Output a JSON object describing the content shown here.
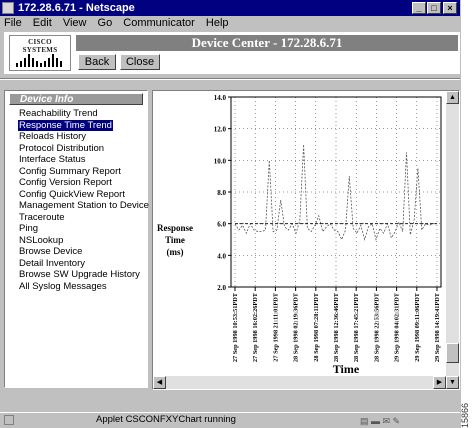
{
  "window": {
    "title": "172.28.6.71 - Netscape"
  },
  "menu": [
    "File",
    "Edit",
    "View",
    "Go",
    "Communicator",
    "Help"
  ],
  "header": {
    "logo_text": "CISCO SYSTEMS",
    "title": "Device Center - 172.28.6.71",
    "back_label": "Back",
    "close_label": "Close"
  },
  "sidebar": {
    "header": "Device Info",
    "items": [
      "Reachability Trend",
      "Response Time Trend",
      "Reloads History",
      "Protocol Distribution",
      "Interface Status",
      "Config Summary Report",
      "Config Version Report",
      "Config QuickView Report",
      "Management Station to Device",
      "Traceroute",
      "Ping",
      "NSLookup",
      "Browse Device",
      "Detail Inventory",
      "Browse SW Upgrade History",
      "All Syslog Messages"
    ],
    "selected_index": 1
  },
  "status": {
    "text": "Applet CSCONFXYChart running"
  },
  "figure_number": "15866",
  "chart_data": {
    "type": "line",
    "ylabel_lines": [
      "Response",
      "Time",
      "(ms)"
    ],
    "xlabel": "Time",
    "ylim": [
      2.0,
      14.0
    ],
    "yticks": [
      "2.0",
      "4.0",
      "6.0",
      "8.0",
      "10.0",
      "12.0",
      "14.0"
    ],
    "xticks": [
      "27 Sep 1998 10:53:51PDT",
      "27 Sep 1998 16:02:26PDT",
      "27 Sep 1998 21:11:01PDT",
      "28 Sep 1998 02:19:36PDT",
      "28 Sep 1998 07:28:11PDT",
      "28 Sep 1998 12:36:46PDT",
      "28 Sep 1998 17:45:21PDT",
      "28 Sep 1998 22:53:56PDT",
      "29 Sep 1998 04:02:31PDT",
      "29 Sep 1998 09:11:06PDT",
      "29 Sep 1998 14:19:41PDT"
    ],
    "grid": true,
    "series": [
      {
        "values": [
          6.0,
          5.6,
          5.9,
          5.4,
          6.0,
          5.6,
          5.5,
          5.5,
          5.6,
          10.0,
          5.5,
          5.6,
          7.5,
          5.8,
          5.6,
          6.0,
          5.4,
          6.2,
          11.0,
          5.7,
          5.5,
          5.9,
          6.5,
          5.5,
          5.8,
          6.0,
          5.6,
          5.5,
          5.0,
          5.6,
          9.0,
          5.7,
          5.4,
          5.9,
          5.0,
          5.8,
          6.0,
          5.0,
          5.7,
          5.4,
          6.0,
          5.1,
          5.5,
          6.1,
          5.5,
          10.5,
          5.3,
          6.2,
          9.5,
          5.6,
          6.0,
          5.9,
          6.0,
          6.0
        ]
      },
      {
        "values": [
          6.0,
          6.0,
          6.0,
          6.0,
          6.0,
          6.0,
          6.0,
          6.0,
          6.0,
          6.0,
          6.0,
          6.0,
          6.0,
          6.0,
          6.0,
          6.0,
          6.0,
          6.0,
          6.0,
          6.0,
          6.0,
          6.0,
          6.0,
          6.0,
          6.0,
          6.0,
          6.0,
          6.0,
          6.0,
          6.0,
          6.0,
          6.0,
          6.0,
          6.0,
          6.0,
          6.0,
          6.0,
          6.0,
          6.0,
          6.0,
          6.0,
          6.0,
          6.0,
          6.0,
          6.0,
          6.0,
          6.0,
          6.0,
          6.0,
          6.0,
          6.0,
          6.0,
          6.0,
          6.0
        ]
      }
    ]
  }
}
